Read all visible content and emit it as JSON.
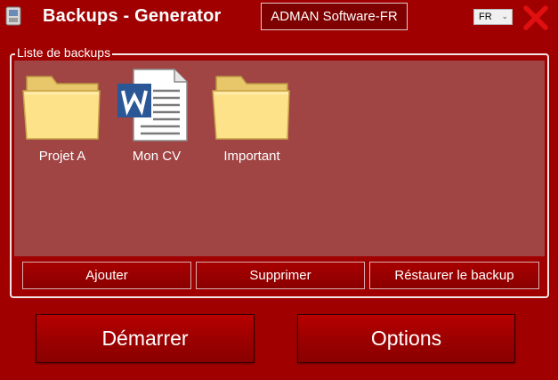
{
  "window": {
    "title": "Backups - Generator",
    "company": "ADMAN Software-FR",
    "language": "FR",
    "close_icon": "close-x-icon",
    "app_icon": "app-icon"
  },
  "colors": {
    "background": "#a00000",
    "list_background": "#a04444",
    "close_red": "#e01010",
    "folder_yellow": "#fde28a"
  },
  "backups": {
    "group_label": "Liste de backups",
    "items": [
      {
        "label": "Projet A",
        "icon": "folder-icon"
      },
      {
        "label": "Mon CV",
        "icon": "word-document-icon"
      },
      {
        "label": "Important",
        "icon": "folder-icon"
      }
    ],
    "add_label": "Ajouter",
    "delete_label": "Supprimer",
    "restore_label": "Réstaurer le backup"
  },
  "footer": {
    "start_label": "Démarrer",
    "options_label": "Options"
  }
}
